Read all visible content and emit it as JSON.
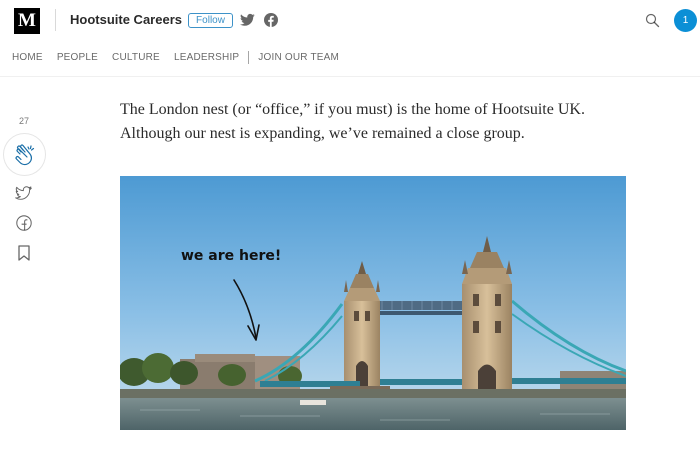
{
  "header": {
    "logo_letter": "M",
    "publication": "Hootsuite Careers",
    "follow_label": "Follow",
    "avatar_initial": "1",
    "icons": [
      "twitter-icon",
      "facebook-icon",
      "search-icon"
    ]
  },
  "nav": {
    "items": [
      "HOME",
      "PEOPLE",
      "CULTURE",
      "LEADERSHIP",
      "JOIN OUR TEAM"
    ]
  },
  "rail": {
    "clap_count": "27",
    "icons": [
      "clap-icon",
      "twitter-icon",
      "facebook-icon",
      "bookmark-icon"
    ]
  },
  "article": {
    "paragraph": "The London nest (or “office,” if you must) is the home of Hootsuite UK. Although our nest is expanding, we’ve remained a close group.",
    "image_annotation": "we are here!"
  },
  "colors": {
    "accent": "#3d92c8",
    "avatar": "#0b8fd6",
    "sky": "#5aa6d8",
    "bridge_cable": "#3aa7b5"
  }
}
